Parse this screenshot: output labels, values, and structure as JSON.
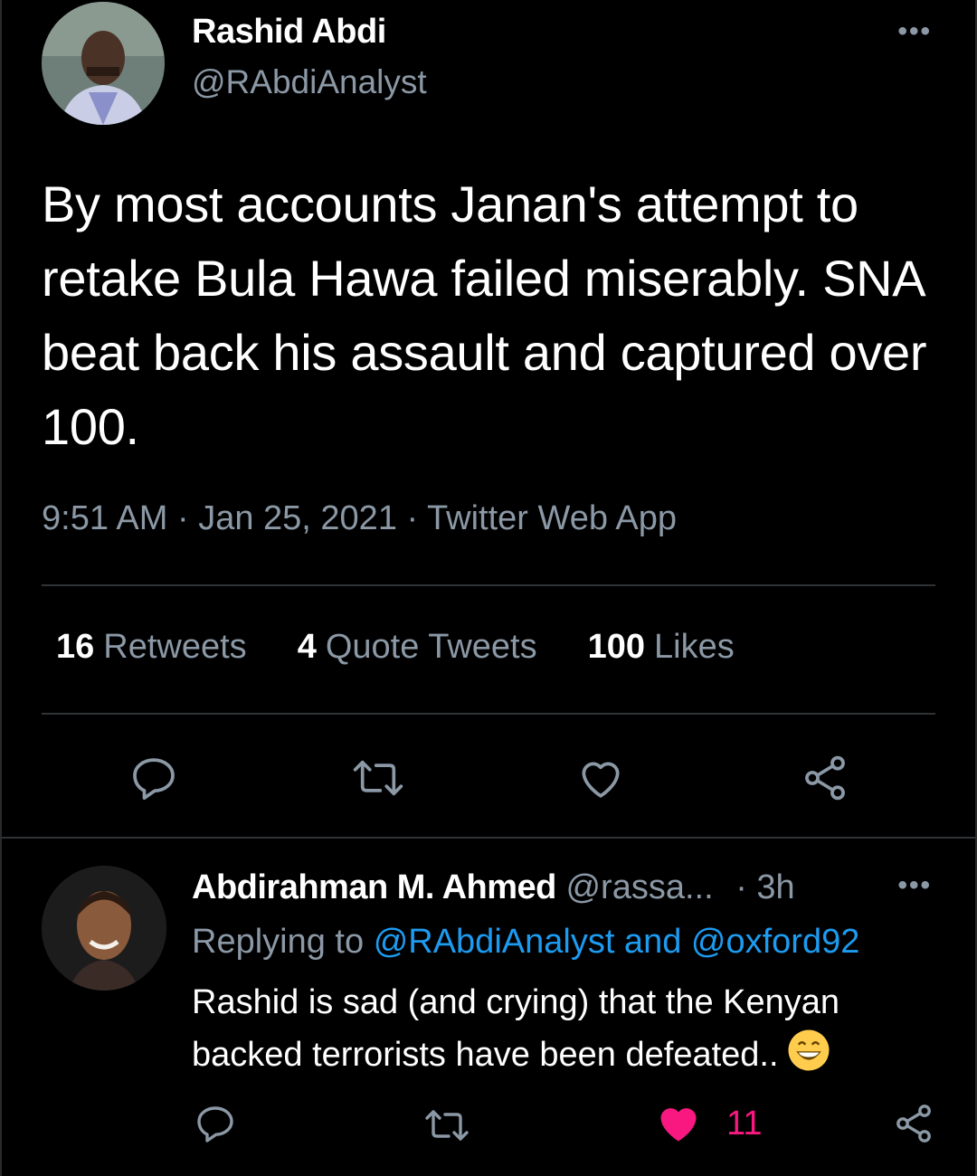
{
  "main_tweet": {
    "author_name": "Rashid Abdi",
    "author_handle": "@RAbdiAnalyst",
    "more_label": "•••",
    "text": "By most accounts Janan's attempt to retake Bula Hawa failed miserably. SNA beat back his assault and captured over 100.",
    "time": "9:51 AM",
    "date": "Jan 25, 2021",
    "source": "Twitter Web App",
    "separator": " · ",
    "stats": {
      "retweets_count": "16",
      "retweets_label": "Retweets",
      "quotes_count": "4",
      "quotes_label": "Quote Tweets",
      "likes_count": "100",
      "likes_label": "Likes"
    },
    "actions": [
      "reply-icon",
      "retweet-icon",
      "like-icon",
      "share-icon"
    ]
  },
  "reply_tweet": {
    "author_name": "Abdirahman M. Ahmed",
    "author_handle": "@rassa...",
    "dot": "·",
    "time": "3h",
    "more_label": "•••",
    "replying_prefix": "Replying to",
    "replying_to": "@RAbdiAnalyst and @oxford92",
    "text": "Rashid is sad (and crying) that the Kenyan backed terrorists have been defeated..",
    "emoji": "grinning-face-icon",
    "like_count": "11",
    "like_color": "#f91880",
    "actions": [
      "reply-icon",
      "retweet-icon",
      "liked-heart-icon",
      "share-icon"
    ]
  },
  "colors": {
    "background": "#000000",
    "secondary_text": "#8b98a5",
    "link": "#1d9bf0",
    "like": "#f91880",
    "divider": "#2f3336"
  }
}
